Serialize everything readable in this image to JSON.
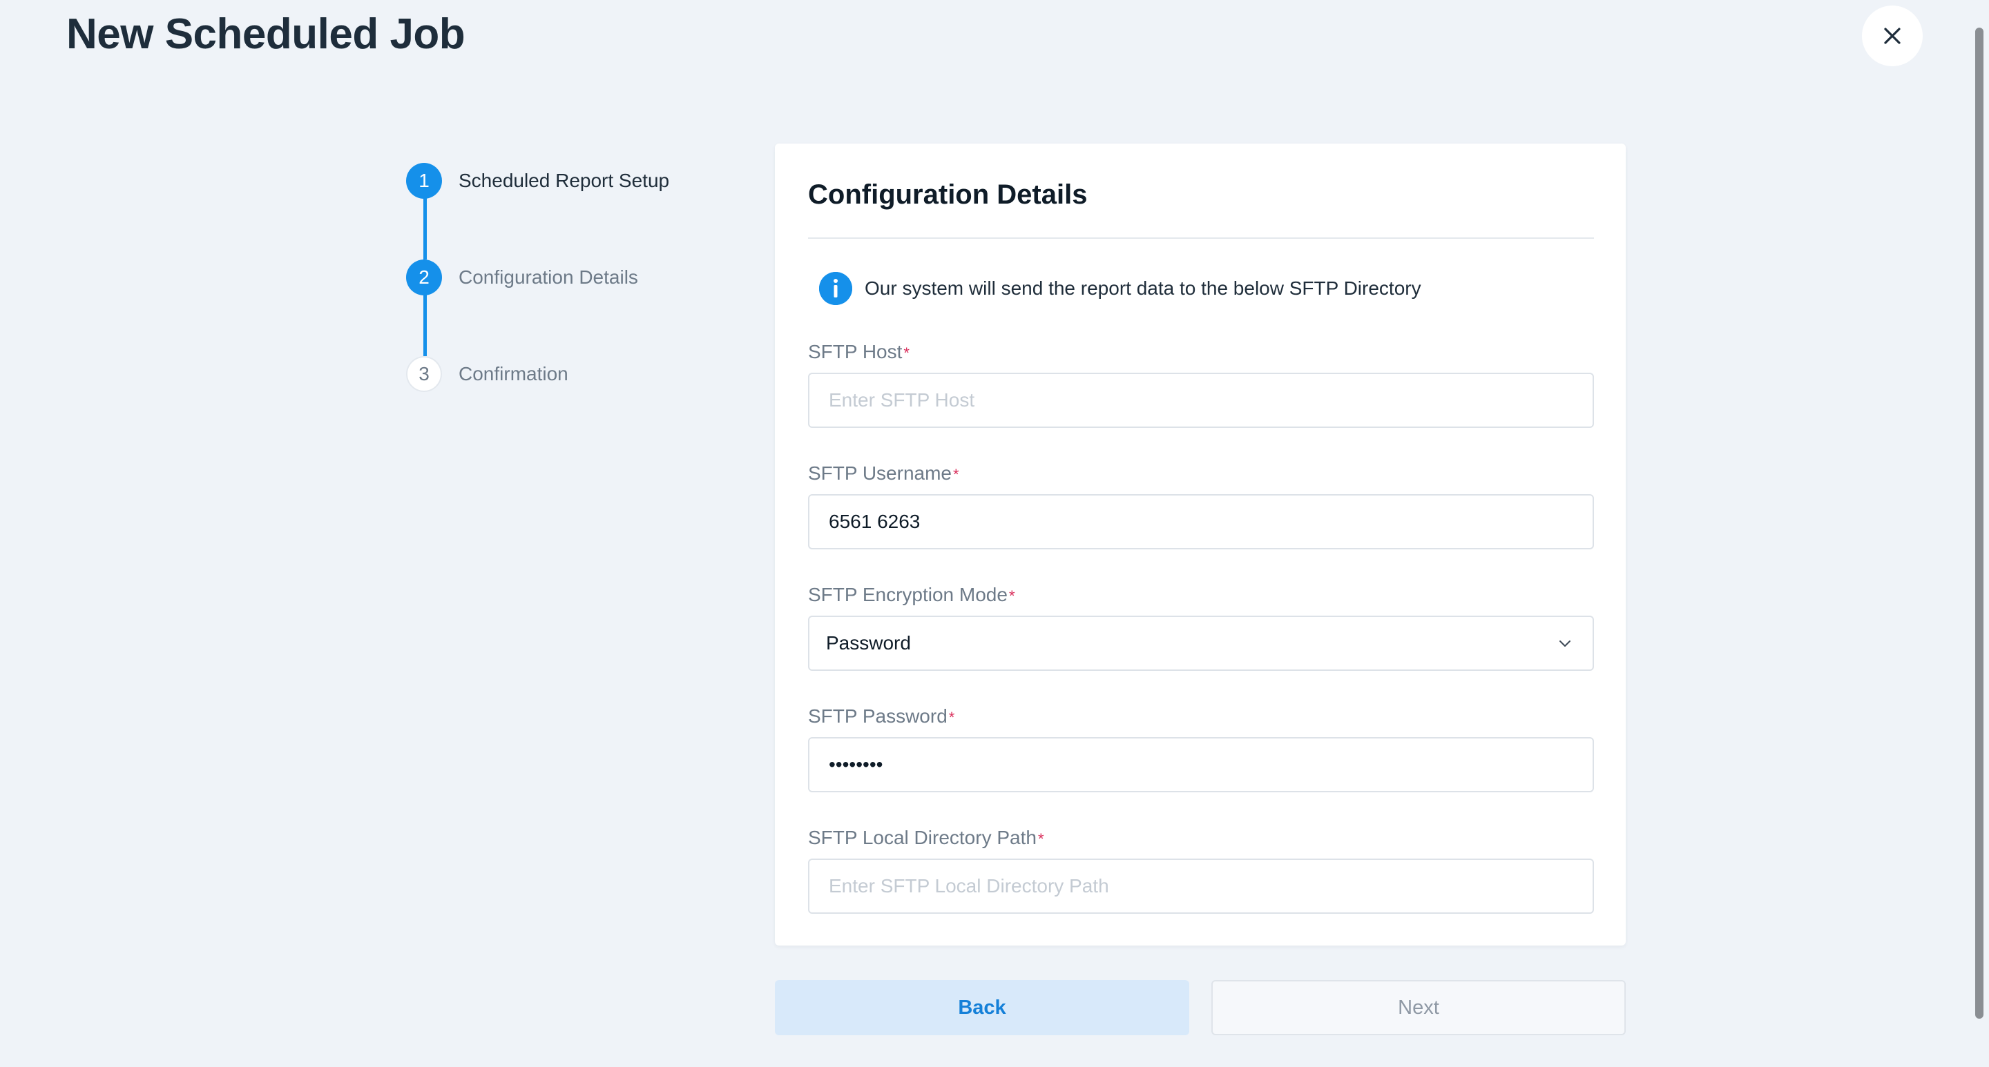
{
  "page": {
    "title": "New Scheduled Job"
  },
  "stepper": {
    "steps": [
      {
        "number": "1",
        "label": "Scheduled Report Setup",
        "state": "completed"
      },
      {
        "number": "2",
        "label": "Configuration Details",
        "state": "active"
      },
      {
        "number": "3",
        "label": "Confirmation",
        "state": "pending"
      }
    ]
  },
  "card": {
    "title": "Configuration Details",
    "info_text": "Our system will send the report data to the below SFTP Directory"
  },
  "form": {
    "host": {
      "label": "SFTP Host",
      "required_mark": "*",
      "value": "",
      "placeholder": "Enter SFTP Host"
    },
    "username": {
      "label": "SFTP Username",
      "required_mark": "*",
      "value": "6561 6263",
      "placeholder": ""
    },
    "encryption_mode": {
      "label": "SFTP Encryption Mode",
      "required_mark": "*",
      "selected": "Password"
    },
    "password": {
      "label": "SFTP Password",
      "required_mark": "*",
      "value": "••••••••",
      "placeholder": ""
    },
    "local_path": {
      "label": "SFTP Local Directory Path",
      "required_mark": "*",
      "value": "",
      "placeholder": "Enter SFTP Local Directory Path"
    }
  },
  "actions": {
    "back_label": "Back",
    "next_label": "Next"
  },
  "colors": {
    "accent": "#1590ea",
    "required": "#d92d5a",
    "background": "#eff3f8"
  },
  "icons": {
    "close": "close-icon",
    "info": "info-icon",
    "dropdown": "chevron-down-icon"
  }
}
